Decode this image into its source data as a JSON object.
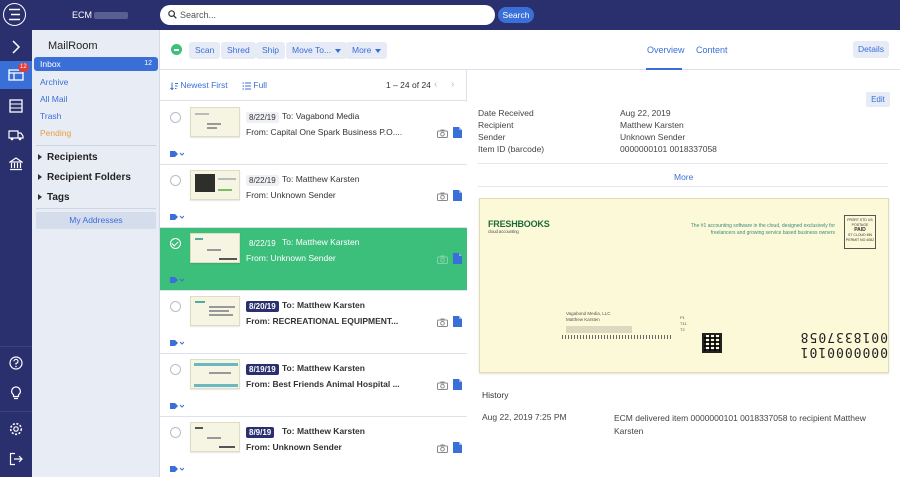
{
  "app": {
    "brand": "ECM"
  },
  "search": {
    "placeholder": "Search...",
    "button_label": "Search"
  },
  "rail": {
    "mail_badge": "12"
  },
  "nav": {
    "title": "MailRoom",
    "items": [
      {
        "label": "Inbox",
        "count": "12"
      },
      {
        "label": "Archive"
      },
      {
        "label": "All Mail"
      },
      {
        "label": "Trash"
      },
      {
        "label": "Pending"
      }
    ],
    "sections": [
      "Recipients",
      "Recipient Folders",
      "Tags"
    ],
    "my_addresses": "My Addresses"
  },
  "toolbar": {
    "buttons": [
      "Scan",
      "Shred",
      "Ship",
      "Move To...",
      "More"
    ],
    "tabs": [
      "Overview",
      "Content"
    ],
    "details": "Details"
  },
  "list": {
    "sort_label": "Newest First",
    "view_label": "Full",
    "range": "1 – 24 of 24",
    "prev": "‹",
    "next": "›",
    "rows": [
      {
        "date": "8/22/19",
        "to": "To:  Vagabond Media",
        "from": "From:  Capital One Spark Business P.O....",
        "unread": false
      },
      {
        "date": "8/22/19",
        "to": "To:  Matthew Karsten",
        "from": "From:  Unknown Sender",
        "unread": false
      },
      {
        "date": "8/22/19",
        "to": "To:  Matthew Karsten",
        "from": "From:  Unknown Sender",
        "unread": false
      },
      {
        "date": "8/20/19",
        "to": "To:  Matthew Karsten",
        "from": "From:  RECREATIONAL EQUIPMENT...",
        "unread": true
      },
      {
        "date": "8/19/19",
        "to": "To:  Matthew Karsten",
        "from": "From:  Best Friends Animal Hospital ...",
        "unread": true
      },
      {
        "date": "8/9/19",
        "to": "To:  Matthew Karsten",
        "from": "From:  Unknown Sender",
        "unread": true
      }
    ]
  },
  "detail": {
    "edit": "Edit",
    "fields": [
      {
        "label": "Date Received",
        "value": "Aug 22, 2019"
      },
      {
        "label": "Recipient",
        "value": "Matthew Karsten"
      },
      {
        "label": "Sender",
        "value": "Unknown Sender"
      },
      {
        "label": "Item ID (barcode)",
        "value": "0000000101 0018337058"
      }
    ],
    "more": "More",
    "envelope": {
      "logo": "FRESHBOOKS",
      "logo_sub": "cloud accounting",
      "tagline": "The #1 accounting software in the cloud, designed exclusively for freelancers and growing service based business owners",
      "stamp_top": "PRSRT STD US POSTAGE",
      "stamp_paid": "PAID",
      "stamp_bottom": "ST CLOUD MN PERMIT NO 4082",
      "addr_line1": "Vagabond Media, LLC",
      "addr_line2": "Matthew Karsten",
      "mid_line1": "P1",
      "mid_line2": "T11",
      "mid_line3": "T2",
      "item_id": "0000000101 0018337058"
    },
    "history_title": "History",
    "history": [
      {
        "date": "Aug 22, 2019 7:25 PM",
        "text": "ECM delivered item 0000000101 0018337058 to recipient Matthew Karsten"
      }
    ]
  }
}
